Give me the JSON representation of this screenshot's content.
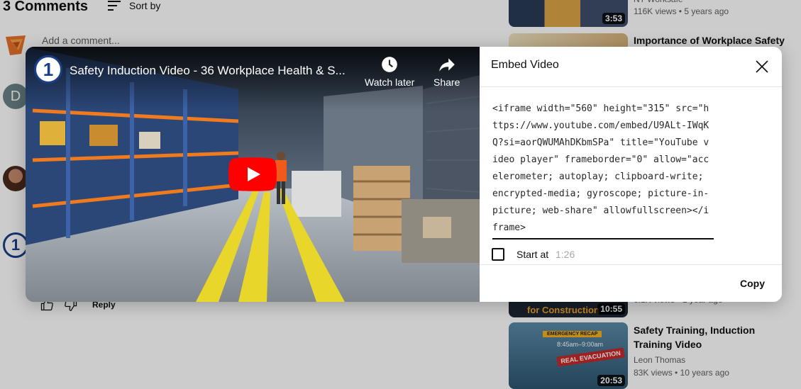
{
  "comments": {
    "count_title": "3 Comments",
    "sort_label": "Sort by",
    "add_placeholder": "Add a comment...",
    "commenter_initial": "D",
    "reply_label": "Reply"
  },
  "sidebar": {
    "videos": [
      {
        "title": "",
        "channel": "NT Worksafe",
        "meta": "116K views • 5 years ago",
        "duration": "3:53"
      },
      {
        "title": "Importance of Workplace Safety",
        "meta": "",
        "duration": ""
      },
      {
        "title": "",
        "meta": "6.1K views • 1 year ago",
        "duration": "10:55",
        "thumb_text": "for Construction"
      },
      {
        "title": "Safety Training, Induction Training Video",
        "channel": "Leon Thomas",
        "meta": "83K views • 10 years ago",
        "duration": "20:53",
        "thumb_badge": "EMERGENCY RECAP",
        "thumb_time": "8:45am–9:00am",
        "thumb_banner": "REAL EVACUATION"
      }
    ]
  },
  "player": {
    "title": "Safety Induction Video - 36 Workplace Health & S...",
    "watch_later_label": "Watch later",
    "share_label": "Share",
    "channel_logo_text": "1"
  },
  "embed": {
    "title": "Embed Video",
    "code": "<iframe width=\"560\" height=\"315\" src=\"https://www.youtube.com/embed/U9ALt-IWqKQ?si=aorQWUMAhDKbmSPa\" title=\"YouTube video player\" frameborder=\"0\" allow=\"accelerometer; autoplay; clipboard-write; encrypted-media; gyroscope; picture-in-picture; web-share\" allowfullscreen></iframe>",
    "start_at_label": "Start at",
    "start_time": "1:26",
    "copy_label": "Copy"
  },
  "colors": {
    "accent_red": "#ff0000",
    "overlay": "rgba(0,0,0,0.2)"
  }
}
